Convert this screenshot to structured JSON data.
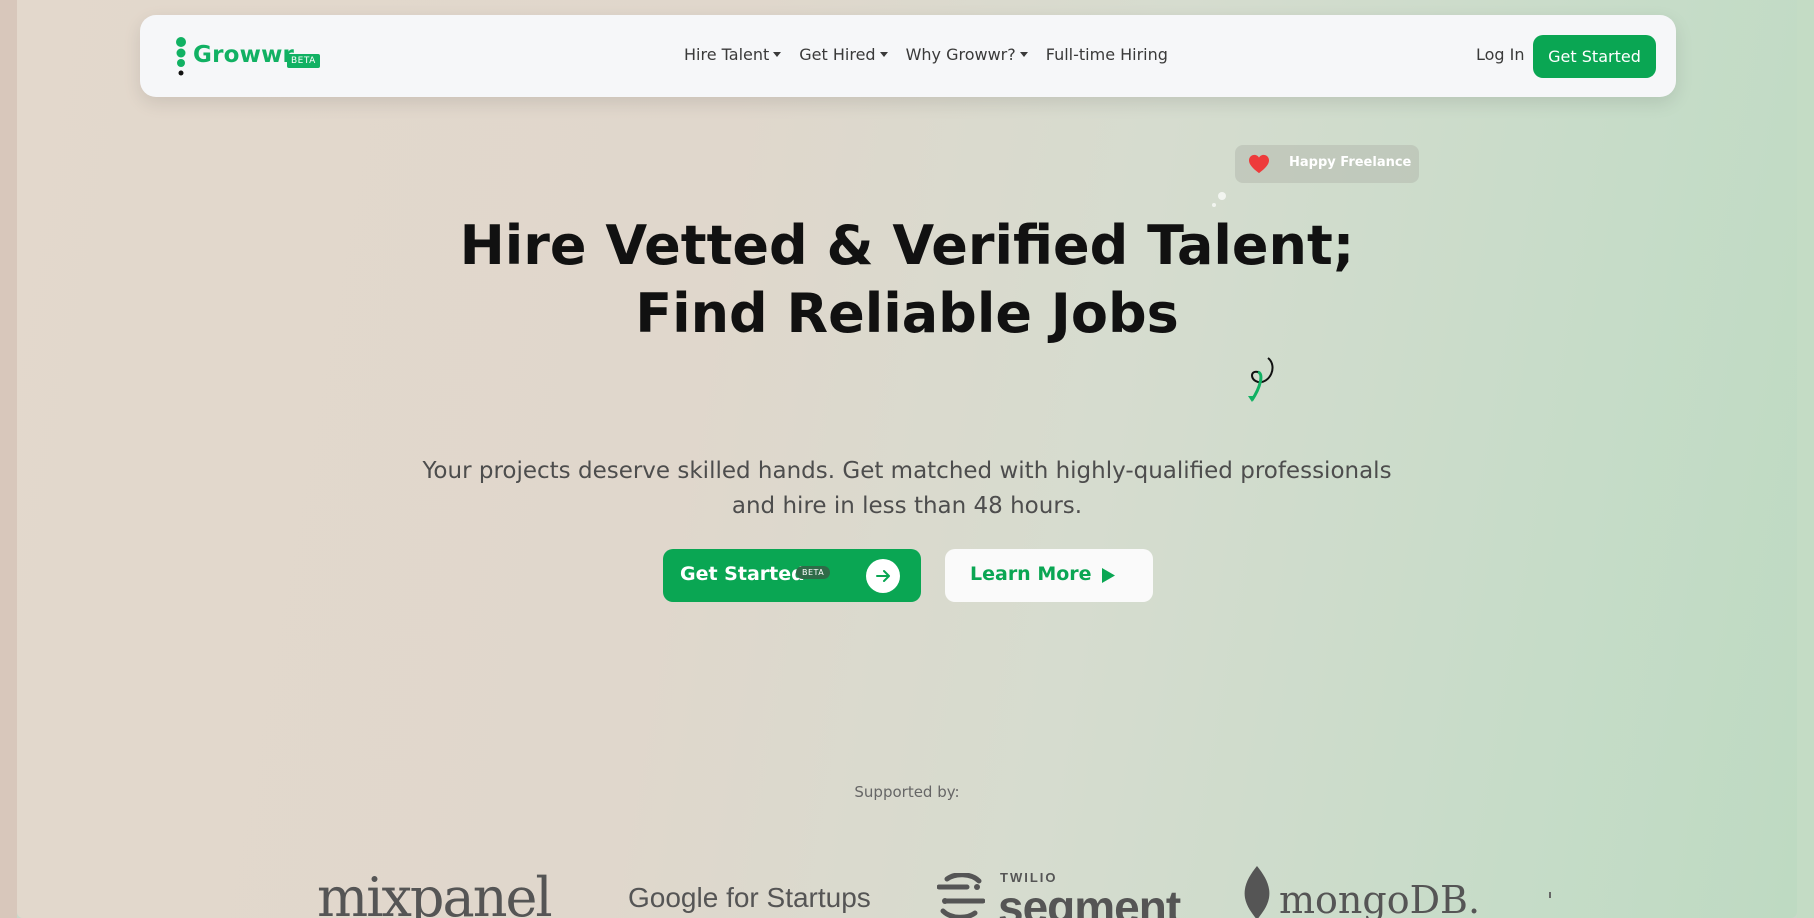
{
  "brand": {
    "name": "Growwr.",
    "badge": "BETA",
    "color": "#11b163"
  },
  "nav": {
    "items": [
      {
        "label": "Hire Talent",
        "has_dropdown": true
      },
      {
        "label": "Get Hired",
        "has_dropdown": true
      },
      {
        "label": "Why Growwr?",
        "has_dropdown": true
      },
      {
        "label": "Full-time Hiring",
        "has_dropdown": false
      }
    ],
    "login_label": "Log In",
    "cta_label": "Get Started"
  },
  "badge": {
    "text": "Happy Freelance",
    "icon": "heart-icon"
  },
  "hero": {
    "title_line1": "Hire Vetted & Verified Talent;",
    "title_line2": "Find Reliable Jobs",
    "subtitle": "Your projects deserve skilled hands. Get matched with highly-qualified professionals and hire in less than 48 hours.",
    "primary_label": "Get Started",
    "primary_badge": "BETA",
    "primary_icon": "arrow-right-icon",
    "secondary_label": "Learn More",
    "secondary_icon": "play-icon"
  },
  "supported": {
    "label": "Supported by:",
    "partners": [
      {
        "name": "mixpanel"
      },
      {
        "name": "Google for Startups"
      },
      {
        "name": "segment",
        "prefix": "TWILIO"
      },
      {
        "name": "mongoDB."
      }
    ]
  },
  "colors": {
    "accent": "#0aa653",
    "text_dark": "#111111",
    "nav_bg": "#f6f7f9"
  }
}
